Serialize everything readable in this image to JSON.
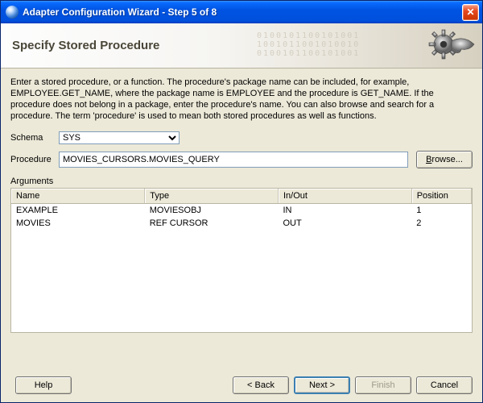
{
  "window": {
    "title": "Adapter Configuration Wizard - Step 5 of 8"
  },
  "banner": {
    "heading": "Specify Stored Procedure"
  },
  "description": "Enter a stored procedure, or a function. The procedure's package name can be included, for example, EMPLOYEE.GET_NAME, where the package name is EMPLOYEE and the procedure is GET_NAME.  If the procedure does not belong in a package, enter the procedure's name. You can also browse and search for a procedure. The term 'procedure' is used to mean both stored procedures as well as functions.",
  "form": {
    "schema_label": "Schema",
    "schema_value": "SYS",
    "procedure_label": "Procedure",
    "procedure_value": "MOVIES_CURSORS.MOVIES_QUERY",
    "browse_label": "Browse..."
  },
  "arguments": {
    "section_label": "Arguments",
    "headers": {
      "name": "Name",
      "type": "Type",
      "inout": "In/Out",
      "position": "Position"
    },
    "rows": [
      {
        "name": "EXAMPLE",
        "type": "MOVIESOBJ",
        "inout": "IN",
        "position": "1"
      },
      {
        "name": "MOVIES",
        "type": "REF CURSOR",
        "inout": "OUT",
        "position": "2"
      }
    ]
  },
  "footer": {
    "help": "Help",
    "back": "< Back",
    "next": "Next >",
    "finish": "Finish",
    "cancel": "Cancel"
  }
}
